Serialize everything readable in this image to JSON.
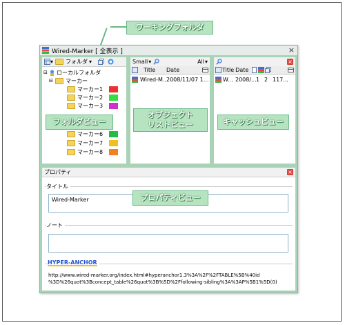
{
  "window": {
    "title": "Wired-Marker [ 全表示 ]",
    "close_glyph": "×"
  },
  "callouts": {
    "working_folder": "ワーキングフォルダ",
    "folder_view": "フォルダビュー",
    "object_list_line1": "オブジェクト",
    "object_list_line2": "リストビュー",
    "cache_view": "キャッシュビュー",
    "property_view": "プロパティビュー"
  },
  "folder_pane": {
    "toolbar_folder_label": "フォルダ",
    "dropdown_glyph": "▾",
    "root_label": "ローカルフォルダ",
    "marker_parent_label": "マーカー",
    "markers": [
      {
        "label": "マーカー1",
        "color": "#ee3030"
      },
      {
        "label": "マーカー2",
        "color": "#33dd44"
      },
      {
        "label": "マーカー3",
        "color": "#cc33cc"
      },
      {
        "label": "マーカー6",
        "color": "#22bb44"
      },
      {
        "label": "マーカー7",
        "color": "#f0c020"
      },
      {
        "label": "マーカー8",
        "color": "#f08020"
      }
    ]
  },
  "object_pane": {
    "view_mode": "Small",
    "filter": "All",
    "columns": [
      "Title",
      "Date"
    ],
    "rows": [
      {
        "title": "Wired-M...",
        "date": "2008/11/07 1..."
      }
    ]
  },
  "cache_pane": {
    "columns": [
      "Title",
      "Date"
    ],
    "rows": [
      {
        "title": "W...",
        "date": "2008/...",
        "c1": "1",
        "c2": "2",
        "c3": "117..."
      }
    ]
  },
  "property": {
    "header": "プロパティ",
    "title_group": "タイトル",
    "title_value": "Wired-Marker",
    "note_group": "ノート",
    "note_value": "",
    "anchor_label": "HYPER-ANCHOR",
    "anchor_line1": "http://www.wired-marker.org/index.html#hyperanchor1.3%3A%2F%2FTABLE%5B%40id",
    "anchor_line2": "%3D%26quot%3Bconcept_table%26quot%3B%5D%2Ffollowing-sibling%3A%3AP%5B1%5D(0)"
  },
  "colors": {
    "accent_green": "#a9d3b6",
    "callout_fill": "#b7e4c0",
    "close_red": "#d9443a",
    "anchor_blue": "#2255cc"
  }
}
